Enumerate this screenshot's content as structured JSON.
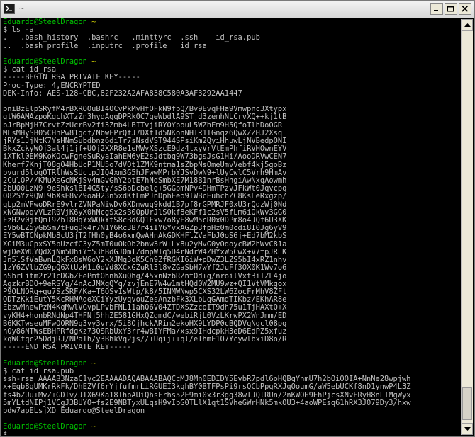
{
  "window": {
    "title": "~"
  },
  "icons": {
    "app": "terminal-icon",
    "minimize": "minimize-icon",
    "maximize": "maximize-icon",
    "close": "close-icon"
  },
  "terminal": {
    "user_host": "Eduardo@SteelDragon",
    "cwd": "~",
    "cmd1": "$ ls -a",
    "ls_line1": ".   .bash_history  .bashrc   .minttyrc  .ssh    id_rsa.pub",
    "ls_line2": "..  .bash_profile  .inputrc  .profile   id_rsa",
    "cmd2": "$ cat id_rsa",
    "key_header": "-----BEGIN RSA PRIVATE KEY-----\nProc-Type: 4,ENCRYPTED\nDEK-Info: AES-128-CBC,82F232A2AFA838C580A3AF3292AA1447",
    "key_body": "pniBzElpSRyfM4rBXROOuBI4OCvPkMvHfOFkN9fbQ/Bv9EvqFHa9Vmwpnc3Xtypx\ngtW6AMAzpoKgchXTzZn3hydAgqDPRk0C7geWbdlA9STjd3zemhNLCrvXQ++kj1tB\nbJrBpMjH7CrvtZzUcrBv2fi3Zmb4LBITvjiRYOYpouL5WZhFm9H5QfoTlhDoOGR\nMLsMHySB05CHhPw81gqf/NbwFPrQfJ7DXt1d5NKonNHTR1TGnqz6QwXZZHJ2Xsq\njRYs1JjNtK7YsHNmSubdbnz6diTr7sNsdVST944SPsiKm2QyiHhuwLjNVBedpONI\nBkxZckyWOj3al4j1jf+UOj2XXR8e1eMWyXSzcE9dz4txyVrVtEmPhfiRVHOwnEYV\niXTkl0EM9KoKQcwFgneSuRyaIahEM6yE2sJdtbq9W73bgsJsG1Hi/AooDRVwCEN7\nKherf7KnjT08gO4HbUcP1MU5o7dVOt1ZMK9ntma1sZbpNsOmeUmvVebf4kj5goBz\nbvurd5logOTRlhWsSUctpJIQ4xm3G5hJFwwMPrbYJSvDwN9+lUyCwlC5Vrh9HmAv\n2CulOP//KMuXsGcNKjSv4mGvGhY2btE7hNdSmbXE7M18B1nrBsHngiAwNxqAowmh\n2bUO0LzN9+9eShkslBI4G5ty/sS6pDcbelg+5GGpmNPv4DHmTPzvJFkWt0Jqvcpq\nO82SYz9QWT9bXsE8vZ9oaH23n5xdKfLmPJnDphEeo9TWBcEuhchZC8KsLeRxgzp/\nqLp2mVFwoDRrE9vlrZVNPaNiwDv6XDmwuq9kdd1B7pf8rGPMRJF0xU3rQqzWj0Nd\nxNGNwpqvVLzR0VjK6yX0hNcgSx2sB0OpUrJlS0kf8eKFf1c2sV5fLm6iQkWv3GG0\nFzH2v0jfQmI9ZbI8HqYxWQkYtS8cBdGQ1Fxw7o8yE8wM5cR0x0DPm8o4JQf6U3XK\ncVb6LZ5yGbSm7tFuqDk4r7N1Y6Rc3B7r4iIY6YvxAGZp3fpHz0m0cdi8I0Jg6yV9\nEY5wBTCNpkMb8cU3jT2fHh0yB4o6xmQwAHnAkGDKHFlZVaFbJ0oS6j+Ed7bM2kbS\nXGiM3uCpxSY5bUzcfG3yZ5mT0uOkOb2bnw3rW+Lx8u2yMvG0yOdoycBW2hWvC81a\nwjDeXWUYQdXjNm5UhiYt53hBdGJ0mIZdmpWTq5D4rNdrW4ZHYxW5CwX+V7tpJRLK\nJn5lSfVaBwnLQkFx8sW6oY2kXJMq3oK5Cn9ZfRGKI6iW+pDwZ3LZS5bI4xRZ1nhv\n1zY6ZVlbZG9pQ6XtUzM1i0qVd8XCxGZuRl3l8vZGaSbH7wYf2JuFf3OX0K1Wv7o6\nhSbrLitm2r21cDGbZFePmtOhnhXuQhg/45xnNzbRZntOd+g/nroilVxt3iTZL4jo\nAgzkrBDO+9eRSYg/4nAcJMXqQYq/zvjEnE7W4w1mtHQd0W2MU9wz+QI1VtVMkgox\nP9OLNORg+qu7SzSRF/Ka+T6OSyIsWtp/k8/5INMWNwp5CXS32LW6ZocFrMhV8ZFt\nODTzKkiEutY5KcRHMAqeXCiYyzUyqvouZesAnzbFk3XLbUqGAmdTIKbz/EKhAR8e\nEbzwMnewPzN4KqMwlVGvpLPvbFNL11ahQ6V04ZTDXSZzcoIT9dh75u1TjHAXtQ+X\nvyKH4+honbRNdNp4THFNj5hhZE581GHxQZgmdC/webiRjL0VzLKrwPX2WnJmm/ED\nB6KKTwseuMFwOORN9q3vy3vrx/5i8OjhckARim2ekoHX9LYDP0cBQDVqNgcl08pg\nhOy86NTWsEBHPRfdgKz73QSRbUxY3rr4wBIYFMa/xsx9IHdcpkH3eD6EdPZ5xfuz\nkqWCfqc25DdjRJ/NPaTh/y3BhkVq2js//+Uqij++ql/eThmF1O7YcywlbxiD8o/R",
    "key_footer": "-----END RSA PRIVATE KEY-----",
    "cmd3": "$ cat id_rsa.pub",
    "pubkey": "ssh-rsa AAAAB3NzaC1yc2EAAAADAQABAAABAQCcMJ8Mn0EDIDY5EvbR7pdl6oHQBqYnmU7h2bOiOOIA+NnNe28wpjwh\nx+Eqb8gUMKrRkFk/DhEZVf6rYjfufmrLiRGUEI3kghBY0BTFPsPi9rsQCbPpgRXJqOoumG/aW5ebUCKf8nD1ynwP4L3Z\nfs4bZUu+MvZ+GDIv/JIX69Ka18ThpAUiQhsFrhs52E9mi0x3r3gg38wTJQlRUn/2nKWOH9EhPjcsXNvFRyH8nLIMgWyx\n5mYLtdNIPj1VCgJ3BUYO+fs2E9NBTyxULqsH9vIbG0TLlX1qt1SVheGWrHNk5mkOU3+4aoWPEsq61hRX3J079Dy3/hxw\nbdw7apELsjXD Eduardo@SteelDragon",
    "prompt_final": "$ "
  }
}
